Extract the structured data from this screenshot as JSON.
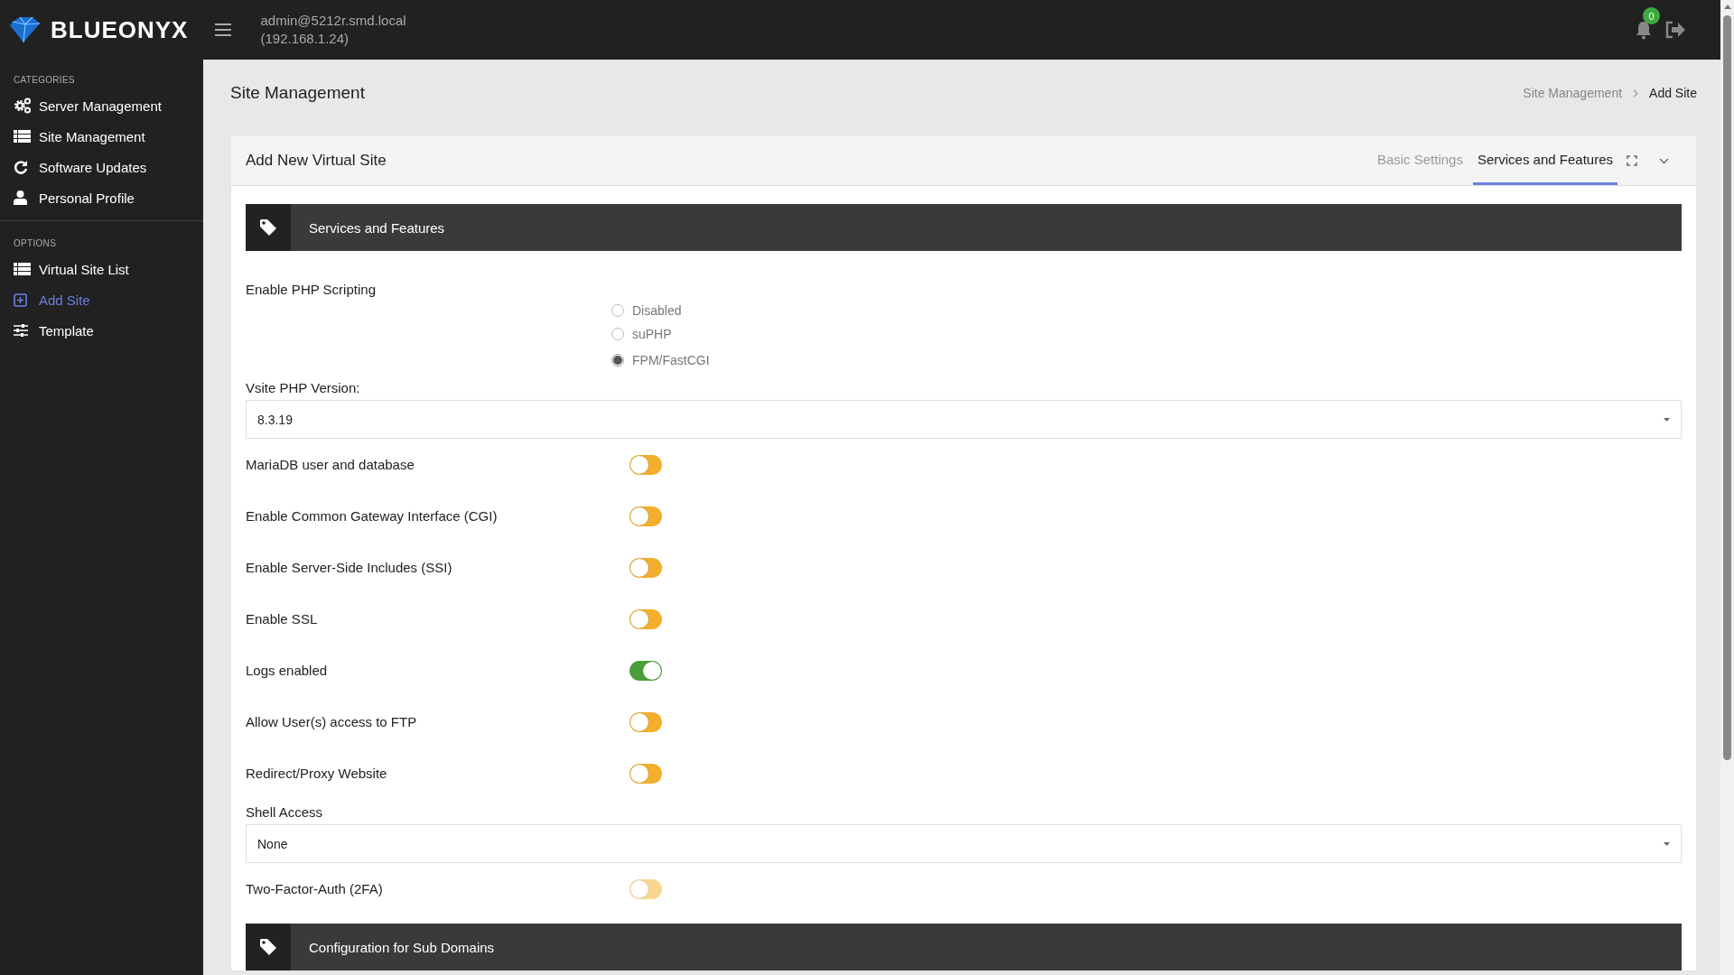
{
  "topbar": {
    "brand": "BLUEONYX",
    "user": "admin@5212r.smd.local",
    "address": "(192.168.1.24)",
    "notification_count": "0"
  },
  "sidebar": {
    "sections": [
      {
        "heading": "CATEGORIES",
        "items": [
          {
            "label": "Server Management",
            "selected": false
          },
          {
            "label": "Site Management",
            "selected": false
          },
          {
            "label": "Software Updates",
            "selected": false
          },
          {
            "label": "Personal Profile",
            "selected": false
          }
        ]
      },
      {
        "heading": "OPTIONS",
        "items": [
          {
            "label": "Virtual Site List",
            "selected": false
          },
          {
            "label": "Add Site",
            "selected": true
          },
          {
            "label": "Template",
            "selected": false
          }
        ]
      }
    ]
  },
  "page": {
    "title": "Site Management",
    "breadcrumb": [
      {
        "label": "Site Management",
        "current": false
      },
      {
        "label": "Add Site",
        "current": true
      }
    ]
  },
  "card": {
    "title": "Add New Virtual Site",
    "tabs": [
      {
        "label": "Basic Settings",
        "selected": false
      },
      {
        "label": "Services and Features",
        "selected": true
      }
    ],
    "sections": [
      {
        "title": "Services and Features",
        "fields": [
          {
            "kind": "radio",
            "label": "Enable PHP Scripting",
            "options": [
              {
                "label": "Disabled",
                "selected": false
              },
              {
                "label": "suPHP",
                "selected": false
              },
              {
                "label": "FPM/FastCGI",
                "selected": true
              }
            ]
          },
          {
            "kind": "select",
            "label": "Vsite PHP Version:",
            "value": "8.3.19"
          },
          {
            "kind": "toggle",
            "label": "MariaDB user and database",
            "on": false,
            "disabled": false
          },
          {
            "kind": "toggle",
            "label": "Enable Common Gateway Interface (CGI)",
            "on": false,
            "disabled": false
          },
          {
            "kind": "toggle",
            "label": "Enable Server-Side Includes (SSI)",
            "on": false,
            "disabled": false
          },
          {
            "kind": "toggle",
            "label": "Enable SSL",
            "on": false,
            "disabled": false
          },
          {
            "kind": "toggle",
            "label": "Logs enabled",
            "on": true,
            "disabled": false
          },
          {
            "kind": "toggle",
            "label": "Allow User(s) access to FTP",
            "on": false,
            "disabled": false
          },
          {
            "kind": "toggle",
            "label": "Redirect/Proxy Website",
            "on": false,
            "disabled": false
          },
          {
            "kind": "select",
            "label": "Shell Access",
            "value": "None"
          },
          {
            "kind": "toggle",
            "label": "Two-Factor-Auth (2FA)",
            "on": false,
            "disabled": true
          }
        ]
      },
      {
        "title": "Configuration for Sub Domains"
      }
    ]
  }
}
